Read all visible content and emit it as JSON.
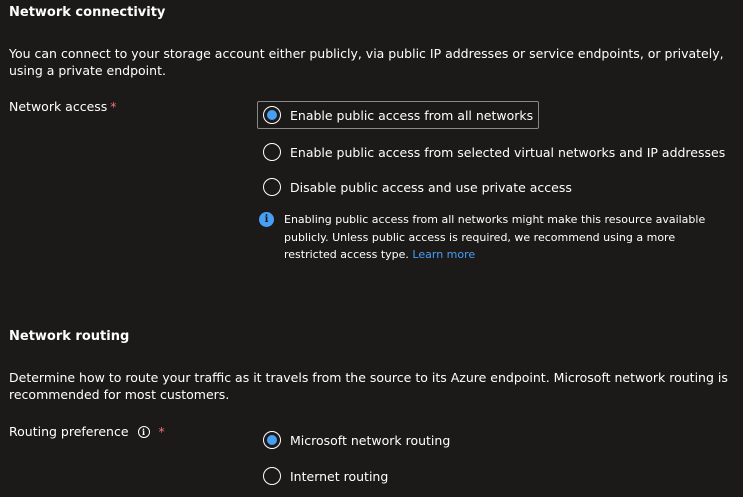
{
  "connectivity": {
    "title": "Network connectivity",
    "description": "You can connect to your storage account either publicly, via public IP addresses or service endpoints, or privately, using a private endpoint.",
    "network_access": {
      "label": "Network access",
      "required_mark": "*",
      "options": [
        {
          "label": "Enable public access from all networks",
          "selected": true
        },
        {
          "label": "Enable public access from selected virtual networks and IP addresses",
          "selected": false
        },
        {
          "label": "Disable public access and use private access",
          "selected": false
        }
      ]
    },
    "info": {
      "icon": "info-icon",
      "text": "Enabling public access from all networks might make this resource available publicly. Unless public access is required, we recommend using a more restricted access type.",
      "link": "Learn more"
    }
  },
  "routing": {
    "title": "Network routing",
    "description": "Determine how to route your traffic as it travels from the source to its Azure endpoint. Microsoft network routing is recommended for most customers.",
    "routing_preference": {
      "label": "Routing preference",
      "info_icon": "info-circle-icon",
      "required_mark": "*",
      "options": [
        {
          "label": "Microsoft network routing",
          "selected": true
        },
        {
          "label": "Internet routing",
          "selected": false
        }
      ]
    }
  },
  "colors": {
    "background": "#1b1a19",
    "accent": "#479ef5",
    "required": "#f1707b"
  }
}
